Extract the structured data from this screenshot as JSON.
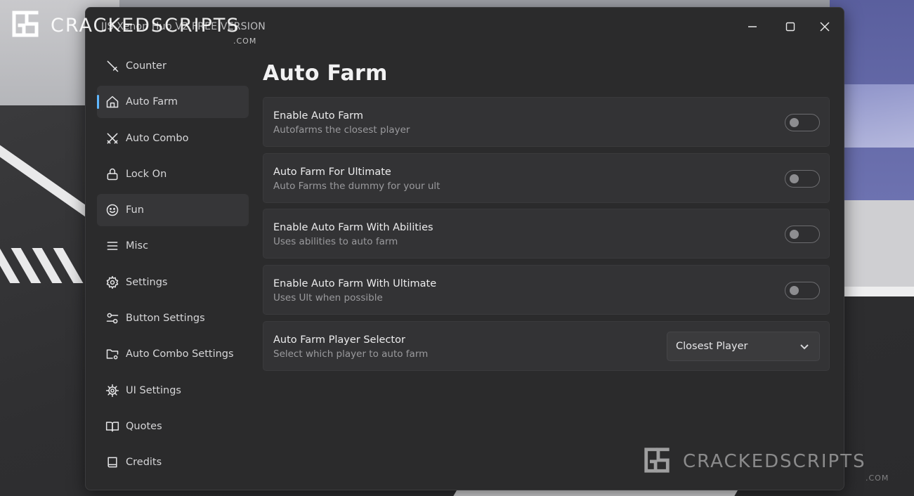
{
  "window": {
    "title": "JJS Xenon Hub V2 FREE VERSION",
    "controls": {
      "minimize": "minimize-icon",
      "maximize": "maximize-icon",
      "close": "close-icon"
    }
  },
  "sidebar": {
    "active_index": 1,
    "items": [
      {
        "label": "Counter",
        "icon": "sword-icon"
      },
      {
        "label": "Auto Farm",
        "icon": "home-icon"
      },
      {
        "label": "Auto Combo",
        "icon": "crossed-swords-icon"
      },
      {
        "label": "Lock On",
        "icon": "lock-icon"
      },
      {
        "label": "Fun",
        "icon": "smile-icon"
      },
      {
        "label": "Misc",
        "icon": "menu-icon"
      },
      {
        "label": "Settings",
        "icon": "gear-icon"
      },
      {
        "label": "Button Settings",
        "icon": "sliders-icon"
      },
      {
        "label": "Auto Combo Settings",
        "icon": "folder-gear-icon"
      },
      {
        "label": "UI Settings",
        "icon": "cog-icon"
      },
      {
        "label": "Quotes",
        "icon": "book-open-icon"
      },
      {
        "label": "Credits",
        "icon": "book-icon"
      }
    ]
  },
  "main": {
    "title": "Auto Farm",
    "rows": [
      {
        "title": "Enable Auto Farm",
        "subtitle": "Autofarms the closest player",
        "type": "toggle",
        "value": false
      },
      {
        "title": "Auto Farm For Ultimate",
        "subtitle": "Auto Farms the dummy for your ult",
        "type": "toggle",
        "value": false
      },
      {
        "title": "Enable Auto Farm With Abilities",
        "subtitle": "Uses abilities to auto farm",
        "type": "toggle",
        "value": false
      },
      {
        "title": "Enable Auto Farm With Ultimate",
        "subtitle": "Uses Ult when possible",
        "type": "toggle",
        "value": false
      },
      {
        "title": "Auto Farm Player Selector",
        "subtitle": "Select which player to auto farm",
        "type": "dropdown",
        "value": "Closest Player"
      }
    ]
  },
  "watermark": {
    "brand": "CRACKEDSCRIPTS",
    "suffix": ".COM"
  },
  "colors": {
    "accent": "#5fb8ff",
    "window_bg": "#2b2b2c",
    "row_bg": "#333335"
  }
}
